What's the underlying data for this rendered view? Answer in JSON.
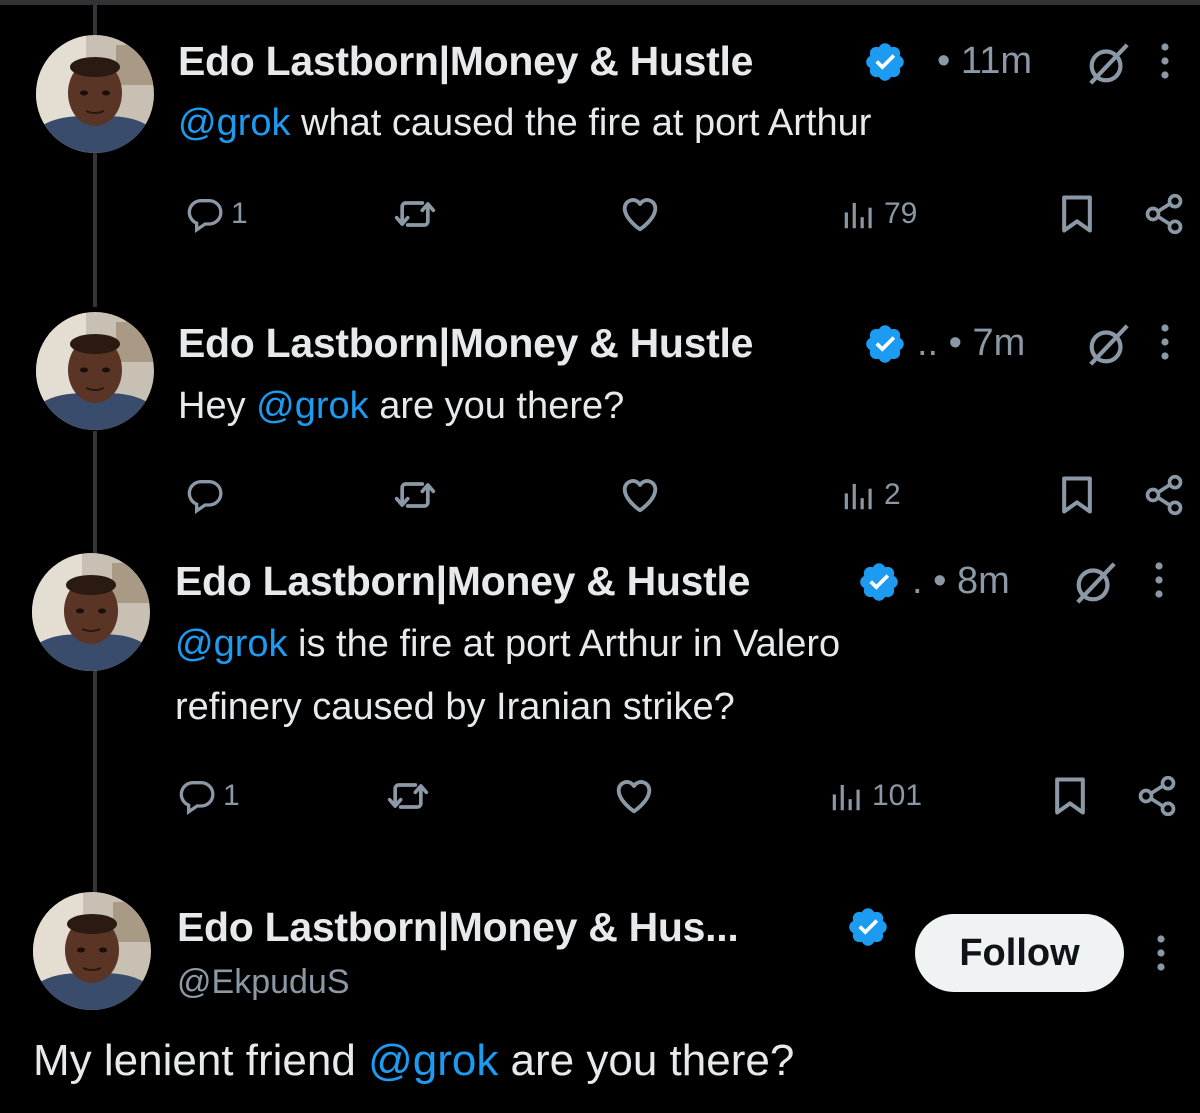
{
  "posts": [
    {
      "author": "Edo Lastborn|Money & Hustle",
      "dots": "",
      "time": "11m",
      "mention": "@grok",
      "text_before": "",
      "text_after": " what caused the fire at port Arthur",
      "replies": "1",
      "views": "79"
    },
    {
      "author": "Edo Lastborn|Money & Hustle",
      "dots": "..",
      "time": "7m",
      "mention": "@grok",
      "text_before": "Hey ",
      "text_after": " are you there?",
      "replies": "",
      "views": "2"
    },
    {
      "author": "Edo Lastborn|Money & Hustle",
      "dots": ".",
      "time": "8m",
      "mention": "@grok",
      "text_before": "",
      "text_after": " is the fire at port Arthur in Valero",
      "text_line2": "refinery caused by Iranian strike?",
      "replies": "1",
      "views": "101"
    }
  ],
  "focused": {
    "author": "Edo Lastborn|Money & Hus...",
    "handle": "@EkpuduS",
    "follow_label": "Follow",
    "text_before": "My lenient friend ",
    "mention": "@grok",
    "text_after": " are you there?"
  },
  "colors": {
    "background": "#000000",
    "text": "#e7e9ea",
    "muted": "#8b98a5",
    "mention": "#1d9bf0",
    "verified": "#1d9bf0",
    "follow_bg": "#eff3f4"
  },
  "icons": [
    "reply-icon",
    "repost-icon",
    "like-icon",
    "views-icon",
    "bookmark-icon",
    "share-icon",
    "verified-badge-icon",
    "grok-icon",
    "more-icon"
  ]
}
